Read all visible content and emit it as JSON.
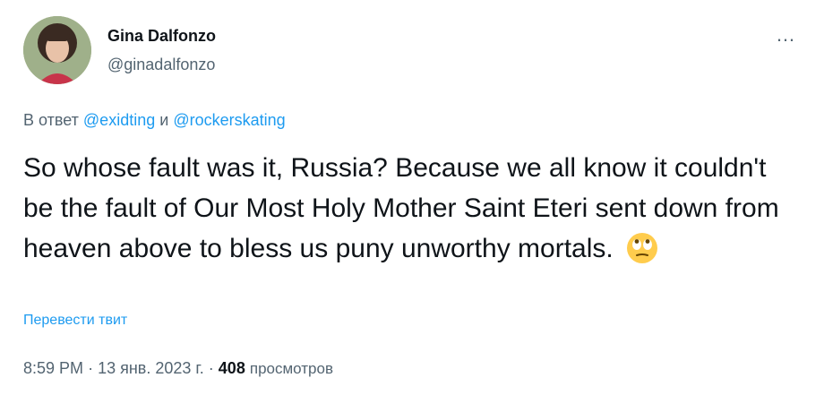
{
  "author": {
    "name": "Gina Dalfonzo",
    "handle": "@ginadalfonzo"
  },
  "more_icon": "…",
  "reply": {
    "prefix": "В ответ",
    "user1": "@exidting",
    "conjunction": "и",
    "user2": "@rockerskating"
  },
  "tweet": {
    "text": "So whose fault was it, Russia? Because we all know it couldn't be the fault of Our Most Holy Mother Saint Eteri sent down from heaven above to bless us puny unworthy mortals.",
    "emoji": "face-with-rolling-eyes"
  },
  "translate_label": "Перевести твит",
  "meta": {
    "time": "8:59 PM",
    "separator": "·",
    "date": "13 янв. 2023 г.",
    "views_count": "408",
    "views_label": "просмотров"
  },
  "colors": {
    "link": "#1d9bf0",
    "secondary_text": "#536471",
    "primary_text": "#0f1419"
  }
}
